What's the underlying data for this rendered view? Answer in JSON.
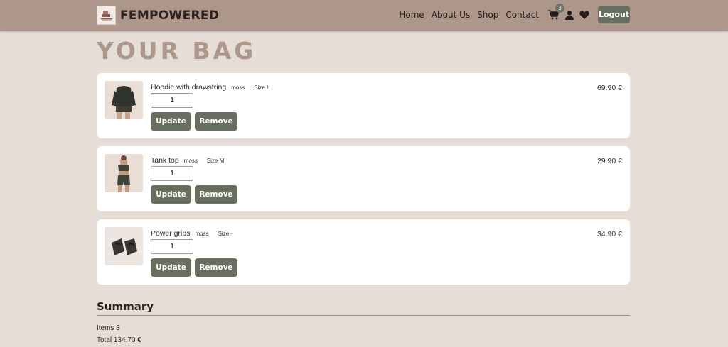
{
  "header": {
    "brand": "FEMPOWERED",
    "nav": [
      "Home",
      "About Us",
      "Shop",
      "Contact"
    ],
    "cart_count": "3",
    "logout_label": "Logout"
  },
  "page": {
    "title": "YOUR BAG"
  },
  "items": [
    {
      "name": "Hoodie with drawstring",
      "color": "moss",
      "size": "Size L",
      "qty": "1",
      "price": "69.90 €",
      "update_label": "Update",
      "remove_label": "Remove"
    },
    {
      "name": "Tank top",
      "color": "moss",
      "size": "Size M",
      "qty": "1",
      "price": "29.90 €",
      "update_label": "Update",
      "remove_label": "Remove"
    },
    {
      "name": "Power grips",
      "color": "moss",
      "size": "Size -",
      "qty": "1",
      "price": "34.90 €",
      "update_label": "Update",
      "remove_label": "Remove"
    }
  ],
  "summary": {
    "title": "Summary",
    "items_line": "Items 3",
    "total_line": "Total 134.70 €"
  },
  "colors": {
    "header_bg": "#ad968a",
    "page_bg": "#e6ddd7",
    "button_bg": "#67705f",
    "title_color": "#ad968a"
  },
  "icons": [
    "brand-logo",
    "cart-icon",
    "user-icon",
    "heart-icon"
  ]
}
